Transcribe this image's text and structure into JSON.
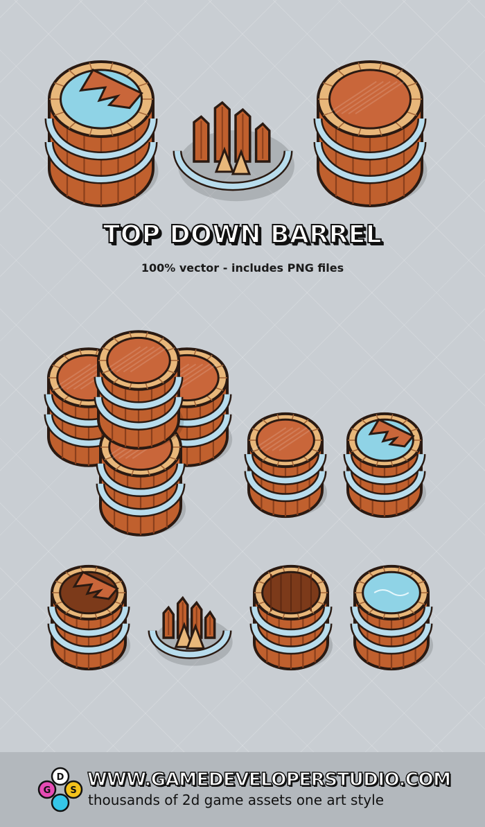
{
  "title": "TOP DOWN  BARREL",
  "subtitle": "100% vector - includes PNG files",
  "footer": {
    "url": "WWW.GAMEDEVELOPERSTUDIO.COM",
    "tagline": "thousands of 2d game assets one art style",
    "logo_letters": [
      "D",
      "G",
      "S"
    ]
  },
  "colors": {
    "background": "#c9ced3",
    "wood": "#c0602e",
    "wood_dark": "#8a3f1c",
    "rim": "#e8b77a",
    "hoop": "#b8dcec",
    "water": "#8fd3e6",
    "outline": "#2a1a12"
  },
  "sprites": [
    {
      "name": "barrel-broken-lid-water",
      "variant": "broken-lid-water"
    },
    {
      "name": "barrel-smashed",
      "variant": "smashed"
    },
    {
      "name": "barrel-closed",
      "variant": "closed"
    },
    {
      "name": "barrel-stack",
      "variant": "stack"
    },
    {
      "name": "barrel-closed-small",
      "variant": "closed"
    },
    {
      "name": "barrel-broken-lid-water-small",
      "variant": "broken-lid-water"
    },
    {
      "name": "barrel-broken-lid-small",
      "variant": "broken-lid"
    },
    {
      "name": "barrel-smashed-small",
      "variant": "smashed"
    },
    {
      "name": "barrel-open-empty-small",
      "variant": "open-empty"
    },
    {
      "name": "barrel-open-water-small",
      "variant": "open-water"
    }
  ]
}
